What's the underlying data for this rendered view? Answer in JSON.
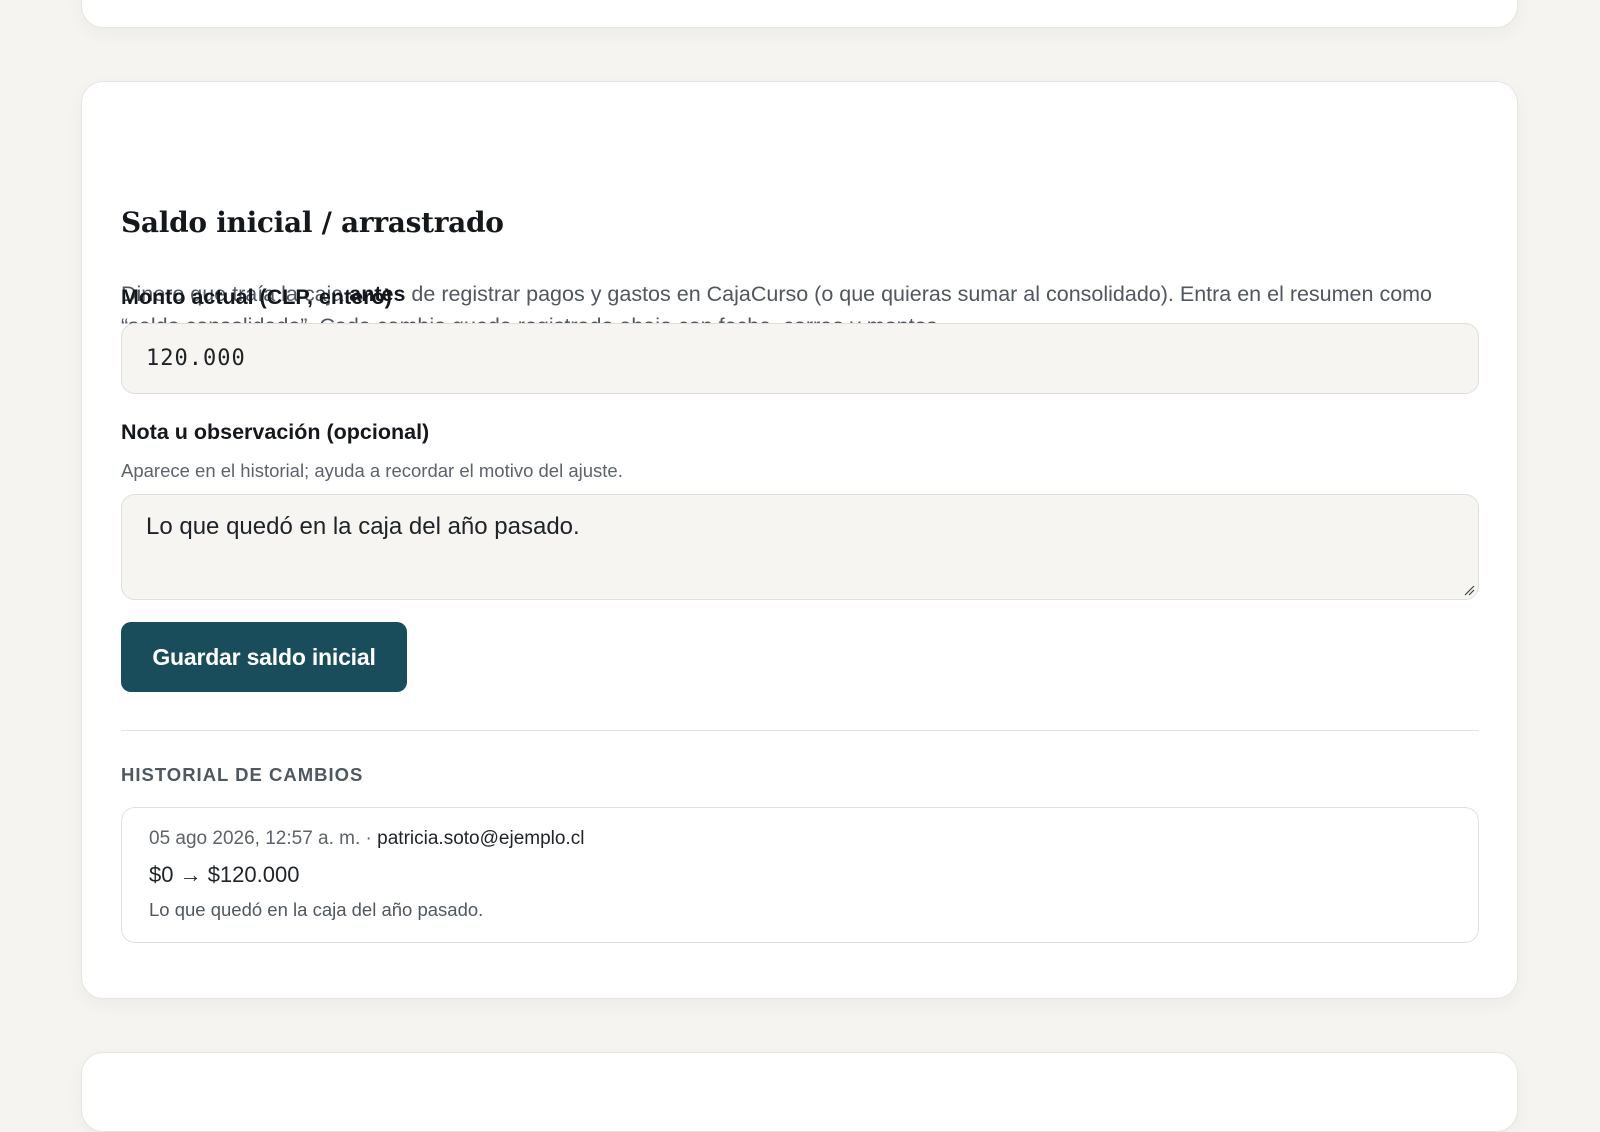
{
  "section": {
    "title": "Saldo inicial / arrastrado",
    "description_before": "Dinero que traía la caja ",
    "description_bold": "antes",
    "description_after": " de registrar pagos y gastos en CajaCurso (o que quieras sumar al consolidado). Entra en el resumen como “saldo consolidado”. Cada cambio queda registrado abajo con fecha, correo y montos."
  },
  "amount": {
    "label": "Monto actual (CLP, entero)",
    "value": "120.000"
  },
  "note": {
    "label": "Nota u observación (opcional)",
    "hint": "Aparece en el historial; ayuda a recordar el motivo del ajuste.",
    "value": "Lo que quedó en la caja del año pasado."
  },
  "save_button": {
    "label": "Guardar saldo inicial"
  },
  "history": {
    "heading": "HISTORIAL DE CAMBIOS",
    "entries": [
      {
        "timestamp": "05 ago 2026, 12:57 a. m.",
        "separator": " · ",
        "email": "patricia.soto@ejemplo.cl",
        "change": "$0 → $120.000",
        "note": "Lo que quedó en la caja del año pasado."
      }
    ]
  },
  "colors": {
    "page_background": "#f5f4f0",
    "card_background": "#ffffff",
    "field_background": "#f6f5f1",
    "primary_button": "#1a4d5c"
  }
}
